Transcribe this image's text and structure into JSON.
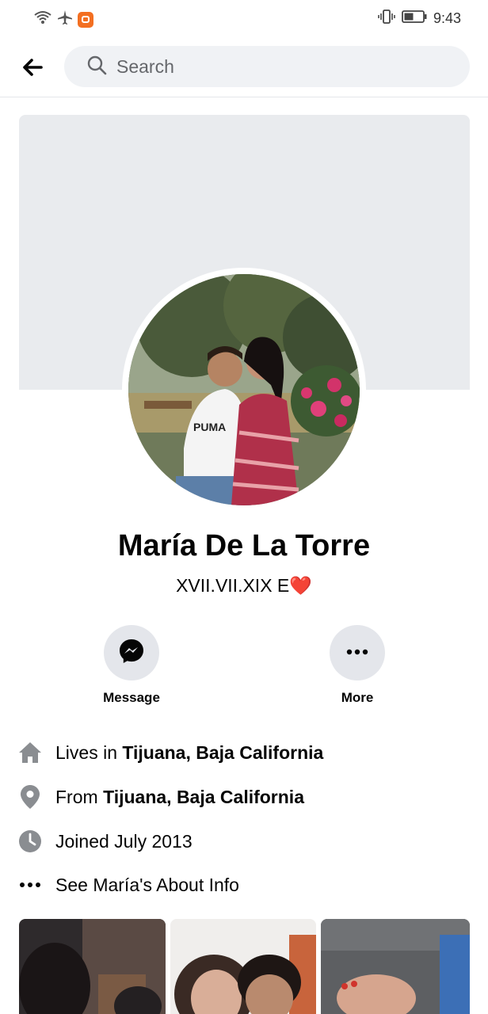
{
  "status_bar": {
    "time": "9:43"
  },
  "search": {
    "placeholder": "Search"
  },
  "profile": {
    "name": "María De La Torre",
    "bio": "XVII.VII.XIX E❤️"
  },
  "actions": [
    {
      "label": "Message",
      "icon": "messenger-icon"
    },
    {
      "label": "More",
      "icon": "more-dots-icon"
    }
  ],
  "info": {
    "lives_prefix": "Lives in ",
    "lives_place": "Tijuana, Baja California",
    "from_prefix": "From ",
    "from_place": "Tijuana, Baja California",
    "joined": "Joined July 2013",
    "about": "See María's About Info"
  },
  "colors": {
    "accent": "#050505",
    "icon_gray": "#8a8d91",
    "surface": "#e4e6eb",
    "cover": "#e9ebee"
  }
}
